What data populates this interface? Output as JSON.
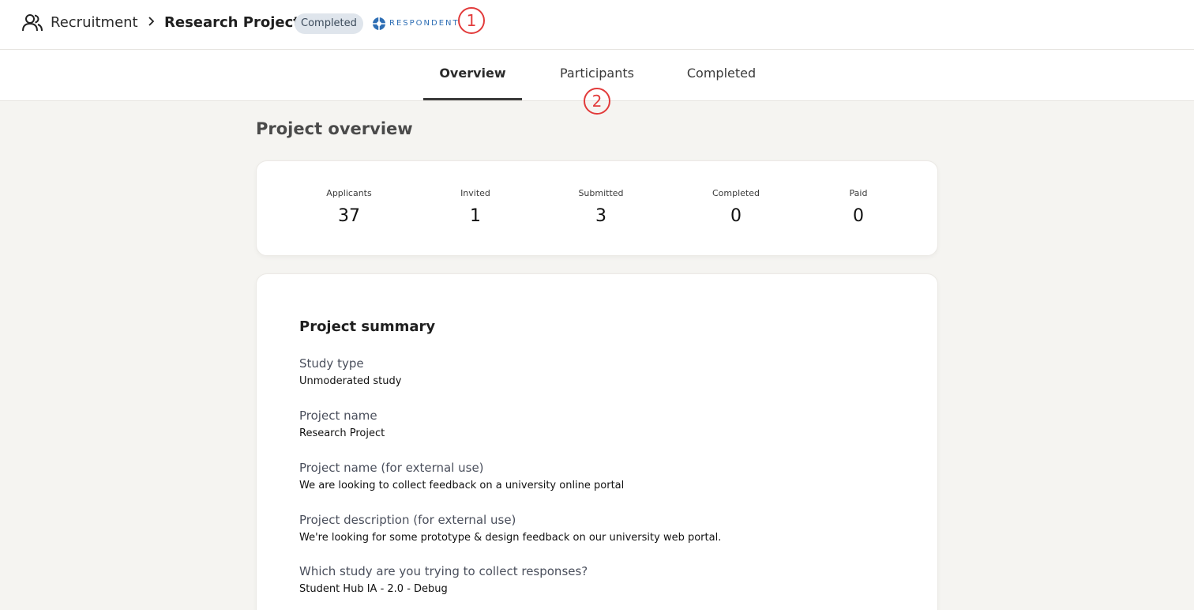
{
  "header": {
    "breadcrumb_root": "Recruitment",
    "breadcrumb_current": "Research Project",
    "status_badge": "Completed",
    "vendor_logo_text": "RESPONDENT",
    "marker_1": "1"
  },
  "tabs": [
    {
      "label": "Overview",
      "active": true
    },
    {
      "label": "Participants",
      "active": false
    },
    {
      "label": "Completed",
      "active": false
    }
  ],
  "marker_2": "2",
  "overview": {
    "title": "Project overview",
    "stats": [
      {
        "label": "Applicants",
        "value": "37"
      },
      {
        "label": "Invited",
        "value": "1"
      },
      {
        "label": "Submitted",
        "value": "3"
      },
      {
        "label": "Completed",
        "value": "0"
      },
      {
        "label": "Paid",
        "value": "0"
      }
    ]
  },
  "summary": {
    "title": "Project summary",
    "fields": [
      {
        "label": "Study type",
        "value": "Unmoderated study"
      },
      {
        "label": "Project name",
        "value": "Research Project"
      },
      {
        "label": "Project name (for external use)",
        "value": "We are looking to collect feedback on a university online portal"
      },
      {
        "label": "Project description (for external use)",
        "value": "We're looking for some prototype & design feedback on our university web portal."
      },
      {
        "label": "Which study are you trying to collect responses?",
        "value": "Student Hub IA - 2.0 - Debug"
      }
    ]
  },
  "colors": {
    "background": "#f5f4f1",
    "badge_bg": "#dfe5ec",
    "vendor_blue": "#2f6fb5",
    "marker_red": "#e23b3b"
  }
}
